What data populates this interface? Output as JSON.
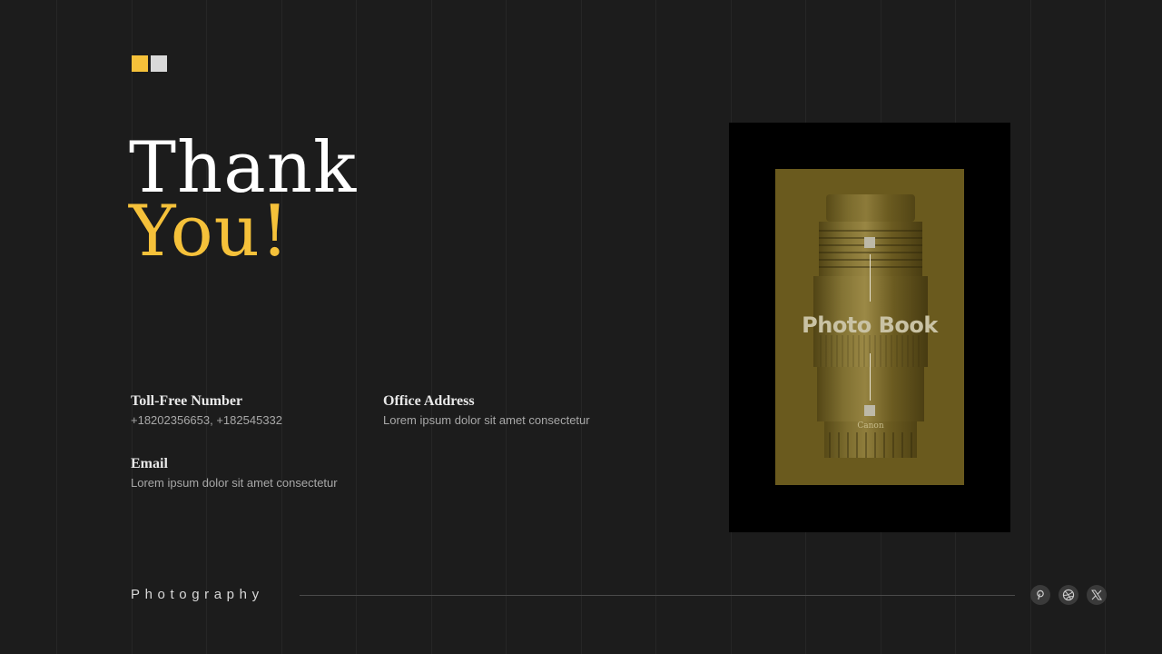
{
  "title": {
    "line1": "Thank",
    "line2": "You!"
  },
  "contact": {
    "toll_free": {
      "label": "Toll-Free Number",
      "value": "+18202356653, +182545332"
    },
    "office": {
      "label": "Office Address",
      "value": "Lorem ipsum dolor sit amet consectetur"
    },
    "email": {
      "label": "Email",
      "value": "Lorem ipsum dolor sit amet consectetur"
    }
  },
  "photo": {
    "caption": "Photo Book",
    "lens_brand": "Canon"
  },
  "footer": {
    "brand": "Photography",
    "social": [
      "pinterest-icon",
      "dribbble-icon",
      "x-icon"
    ]
  },
  "colors": {
    "background": "#1c1c1c",
    "accent": "#f5c13a",
    "text_primary": "#ffffff",
    "square_light": "#d9d9d9"
  }
}
